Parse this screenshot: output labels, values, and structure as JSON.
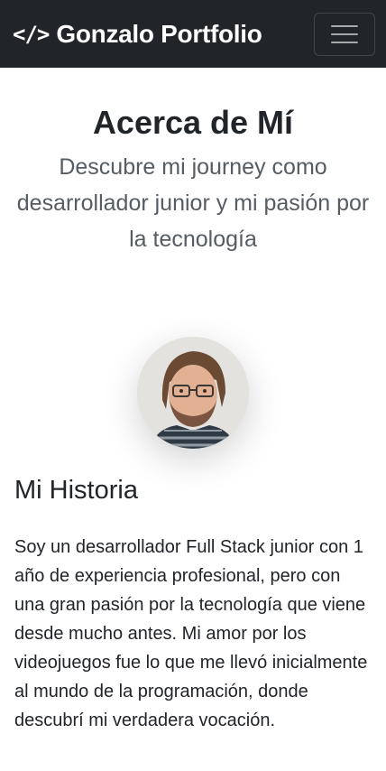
{
  "navbar": {
    "brand_icon": "</>",
    "brand_text": "Gonzalo Portfolio",
    "toggler_icon": "hamburger-icon"
  },
  "hero": {
    "title": "Acerca de Mí",
    "subtitle": "Descubre mi journey como desarrollador junior y mi pasión por la tecnología"
  },
  "profile": {
    "avatar_icon": "profile-photo"
  },
  "story": {
    "heading": "Mi Historia",
    "text": "Soy un desarrollador Full Stack junior con 1 año de experiencia profesional, pero con una gran pasión por la tecnología que viene desde mucho antes. Mi amor por los videojuegos fue lo que me llevó inicialmente al mundo de la programación, donde descubrí mi verdadera vocación."
  },
  "colors": {
    "navbar_bg": "#212529",
    "text": "#212529",
    "subtitle": "#555c63"
  }
}
